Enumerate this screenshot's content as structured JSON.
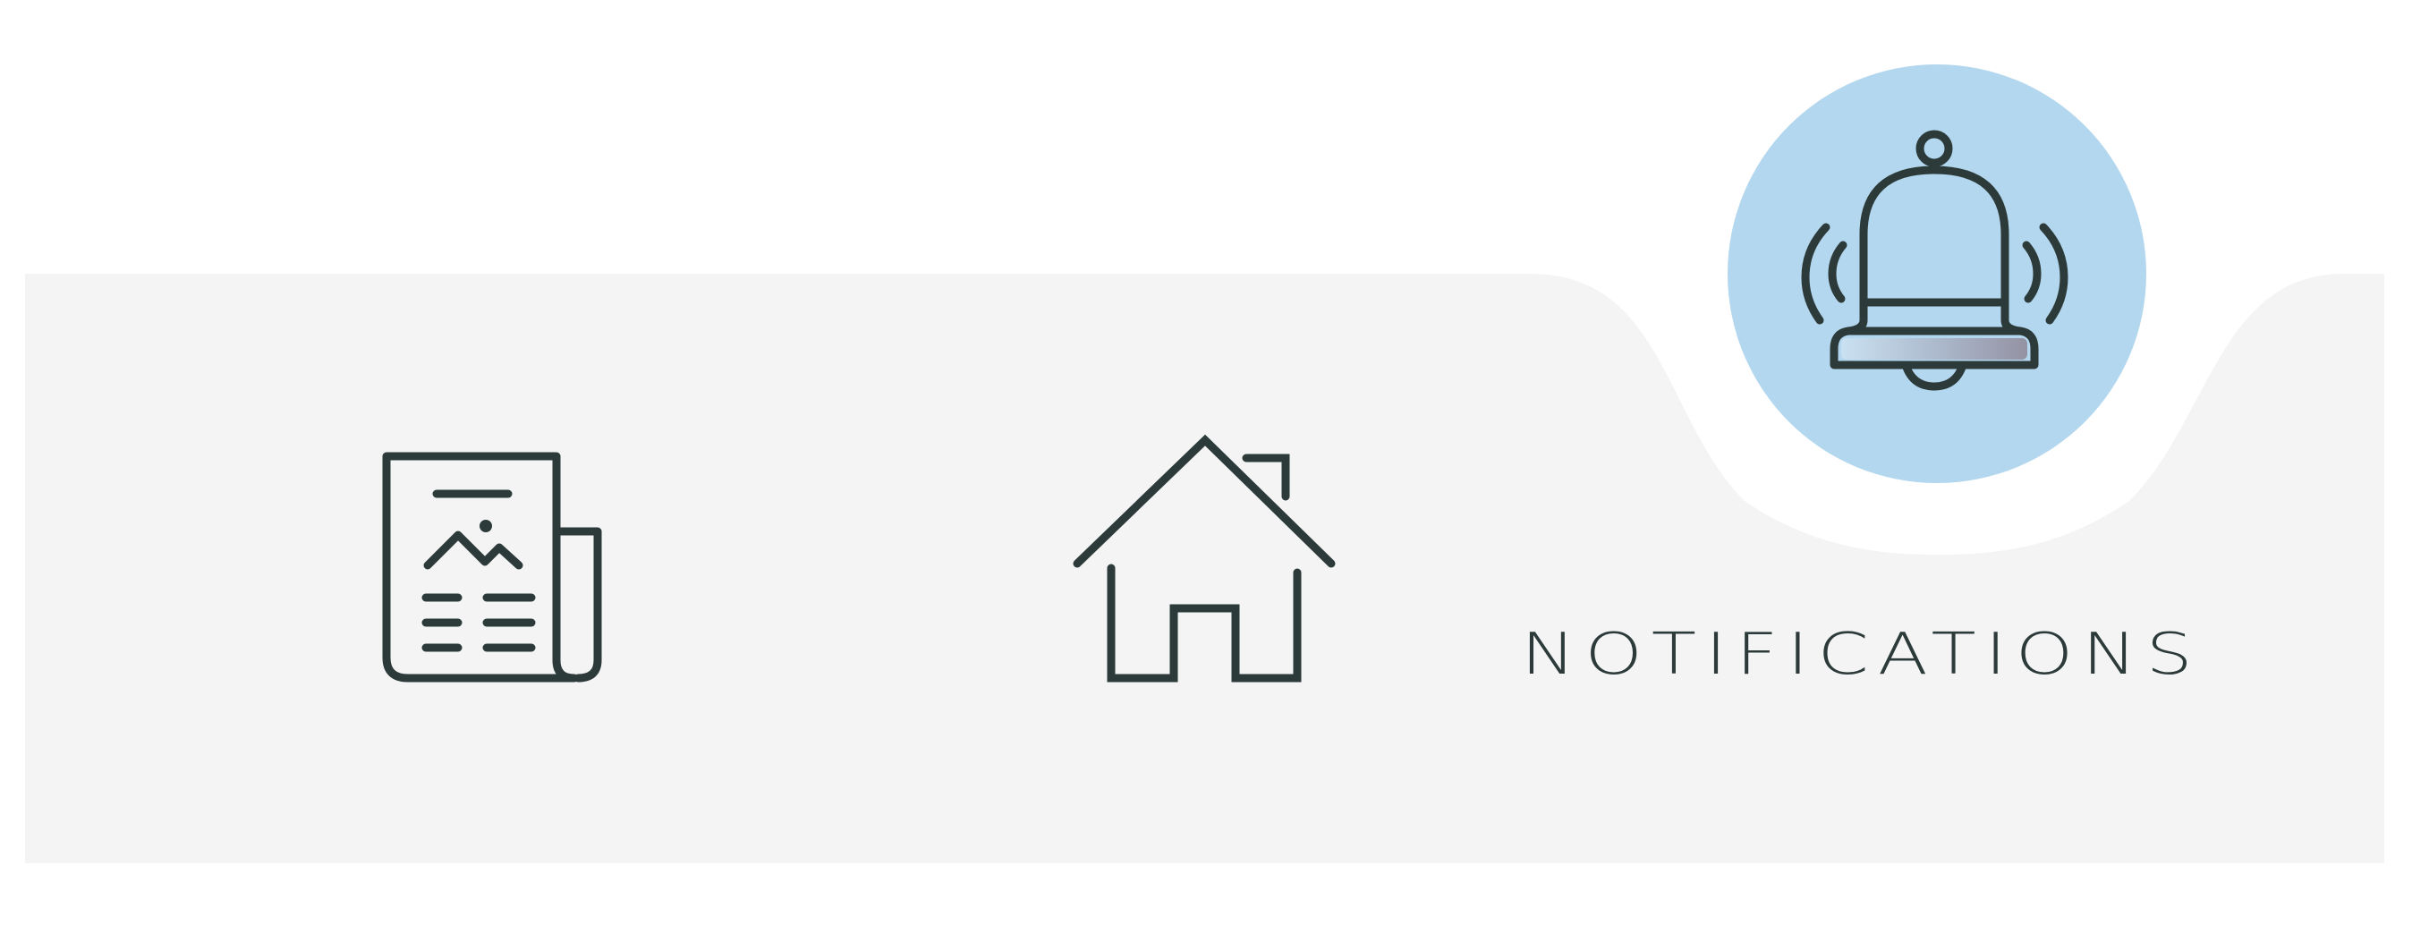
{
  "nav": {
    "items": [
      {
        "id": "news",
        "icon": "newspaper-icon",
        "label": ""
      },
      {
        "id": "home",
        "icon": "house-icon",
        "label": ""
      },
      {
        "id": "notifications",
        "icon": "bell-icon",
        "label": "NOTIFICATIONS",
        "active": true
      }
    ]
  },
  "colors": {
    "bar_background": "#f4f4f4",
    "page_background": "#ffffff",
    "active_circle": "#b3d7ee",
    "icon_stroke": "#2c3a3a"
  }
}
